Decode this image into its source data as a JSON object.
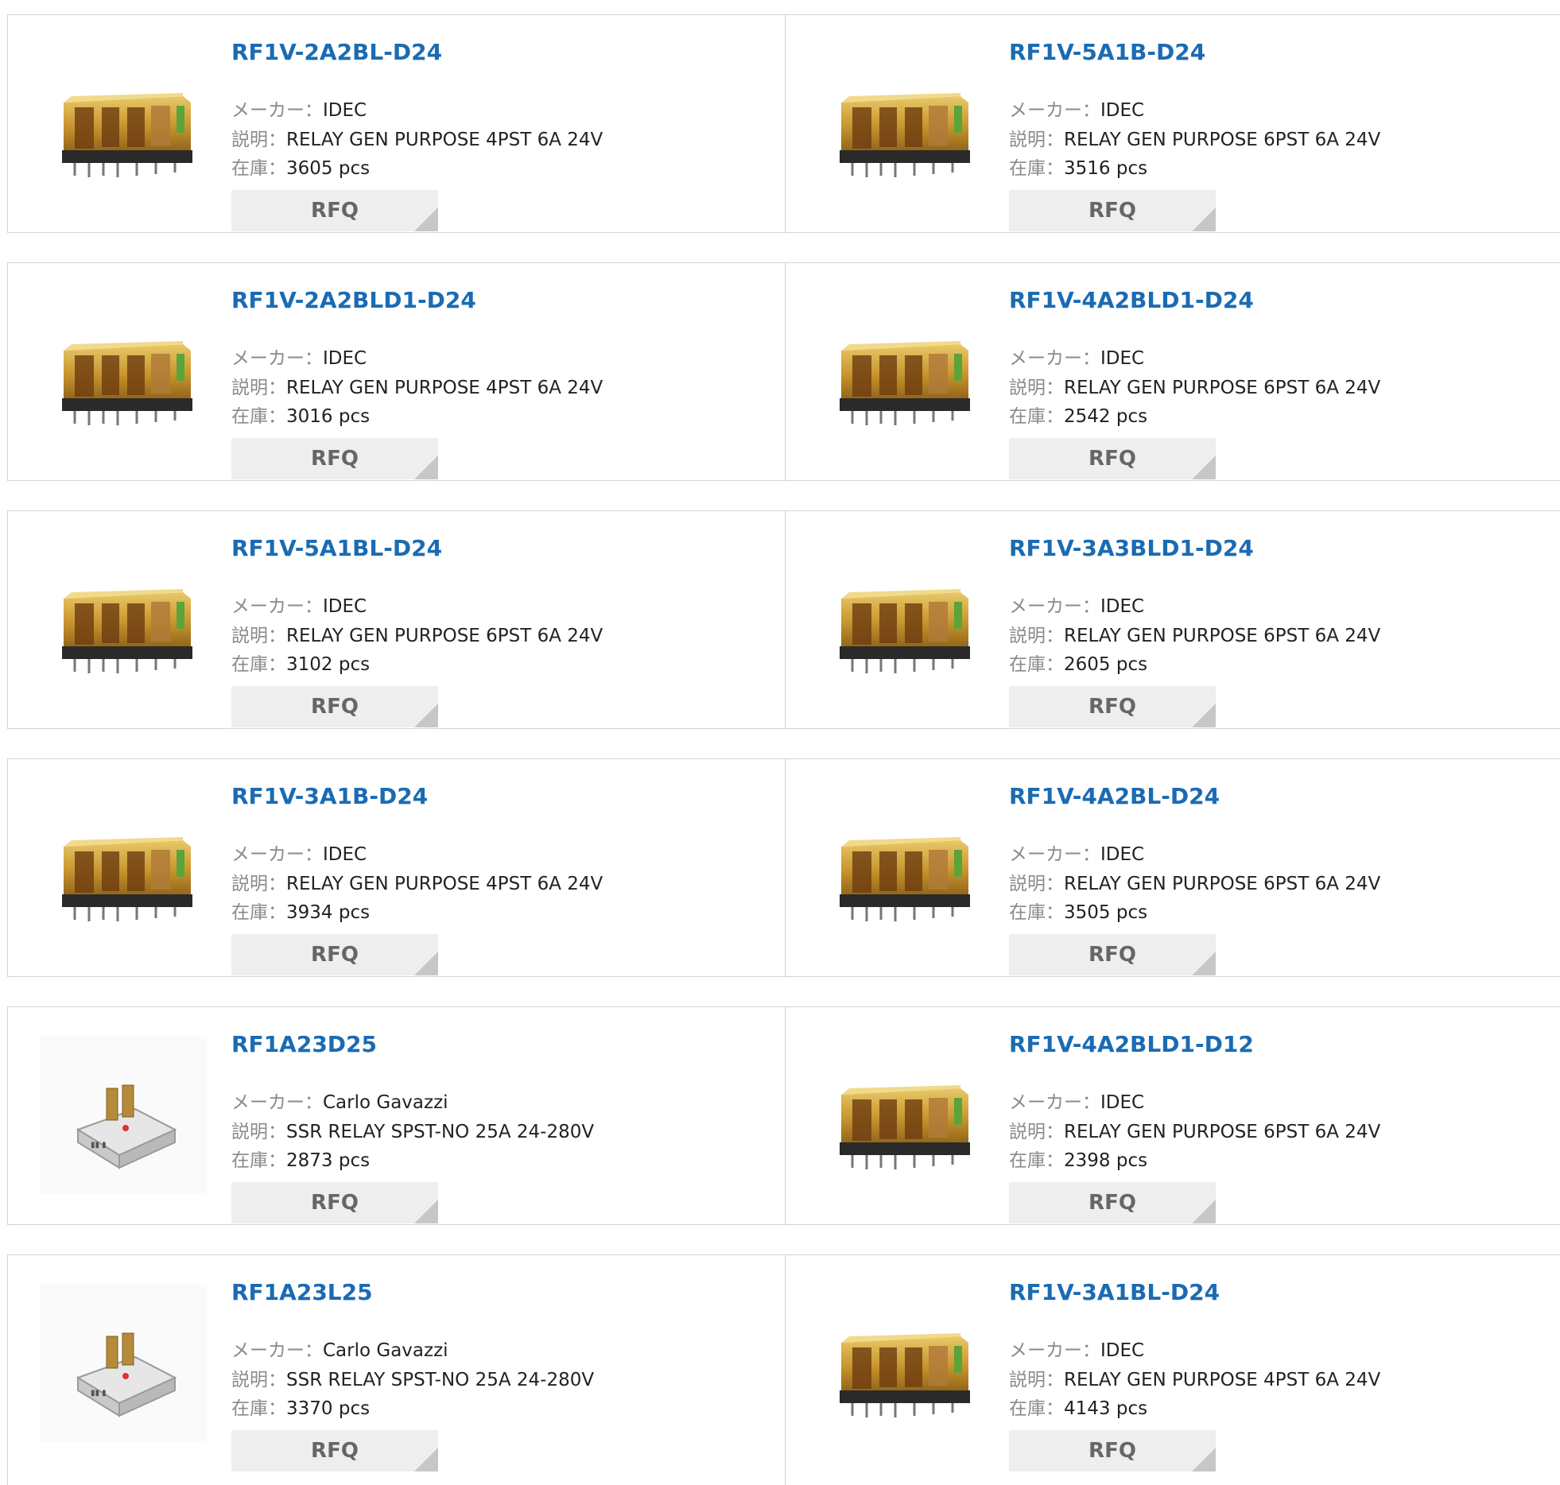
{
  "labels": {
    "maker": "メーカー：",
    "desc": "説明：",
    "stock": "在庫：",
    "rfq": "RFQ"
  },
  "rows": [
    [
      {
        "pn": "RF1V-2A2BL-D24",
        "maker": "IDEC",
        "desc": "RELAY GEN PURPOSE 4PST 6A 24V",
        "stock": "3605 pcs",
        "image": "idec-relay-image"
      },
      {
        "pn": "RF1V-5A1B-D24",
        "maker": "IDEC",
        "desc": "RELAY GEN PURPOSE 6PST 6A 24V",
        "stock": "3516 pcs",
        "image": "idec-relay-image"
      }
    ],
    [
      {
        "pn": "RF1V-2A2BLD1-D24",
        "maker": "IDEC",
        "desc": "RELAY GEN PURPOSE 4PST 6A 24V",
        "stock": "3016 pcs",
        "image": "idec-relay-image"
      },
      {
        "pn": "RF1V-4A2BLD1-D24",
        "maker": "IDEC",
        "desc": "RELAY GEN PURPOSE 6PST 6A 24V",
        "stock": "2542 pcs",
        "image": "idec-relay-image"
      }
    ],
    [
      {
        "pn": "RF1V-5A1BL-D24",
        "maker": "IDEC",
        "desc": "RELAY GEN PURPOSE 6PST 6A 24V",
        "stock": "3102 pcs",
        "image": "idec-relay-image"
      },
      {
        "pn": "RF1V-3A3BLD1-D24",
        "maker": "IDEC",
        "desc": "RELAY GEN PURPOSE 6PST 6A 24V",
        "stock": "2605 pcs",
        "image": "idec-relay-image"
      }
    ],
    [
      {
        "pn": "RF1V-3A1B-D24",
        "maker": "IDEC",
        "desc": "RELAY GEN PURPOSE 4PST 6A 24V",
        "stock": "3934 pcs",
        "image": "idec-relay-image"
      },
      {
        "pn": "RF1V-4A2BL-D24",
        "maker": "IDEC",
        "desc": "RELAY GEN PURPOSE 6PST 6A 24V",
        "stock": "3505 pcs",
        "image": "idec-relay-image"
      }
    ],
    [
      {
        "pn": "RF1A23D25",
        "maker": "Carlo Gavazzi",
        "desc": "SSR RELAY SPST-NO 25A 24-280V",
        "stock": "2873 pcs",
        "image": "ssr-relay-image"
      },
      {
        "pn": "RF1V-4A2BLD1-D12",
        "maker": "IDEC",
        "desc": "RELAY GEN PURPOSE 6PST 6A 24V",
        "stock": "2398 pcs",
        "image": "idec-relay-image"
      }
    ],
    [
      {
        "pn": "RF1A23L25",
        "maker": "Carlo Gavazzi",
        "desc": "SSR RELAY SPST-NO 25A 24-280V",
        "stock": "3370 pcs",
        "image": "ssr-relay-image"
      },
      {
        "pn": "RF1V-3A1BL-D24",
        "maker": "IDEC",
        "desc": "RELAY GEN PURPOSE 4PST 6A 24V",
        "stock": "4143 pcs",
        "image": "idec-relay-image"
      }
    ]
  ]
}
